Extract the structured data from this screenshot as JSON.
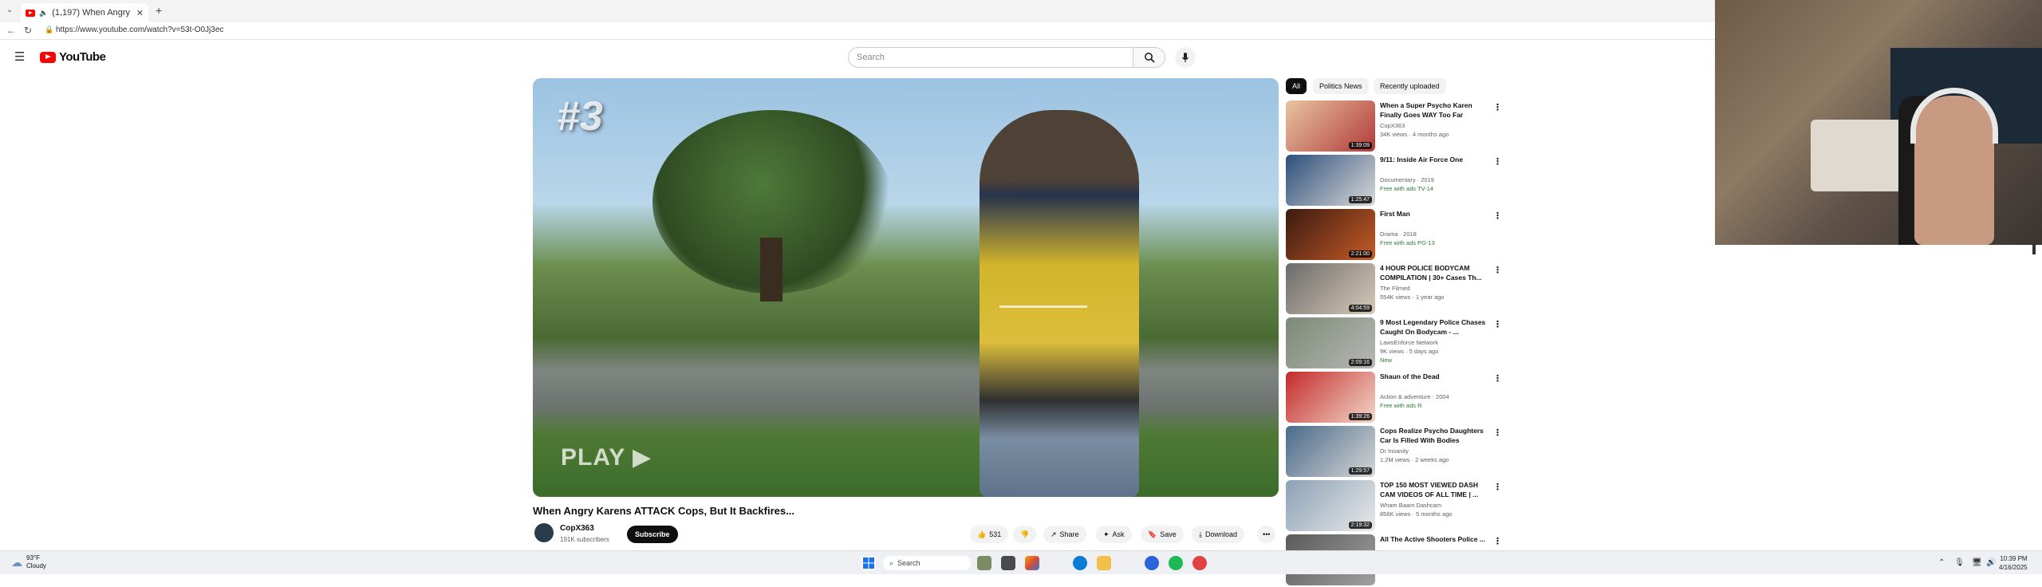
{
  "browser": {
    "tab_title": "(1,197) When Angry Karens ATTACK Cops, But It Backfires...",
    "url": "https://www.youtube.com/watch?v=53t-O0Jj3ec",
    "new_tab_label": "+"
  },
  "header": {
    "logo_text": "YouTube",
    "search_placeholder": "Search"
  },
  "video": {
    "overlay_rank": "#3",
    "overlay_watermark": "PLAY ▶",
    "title": "When Angry Karens ATTACK Cops, But It Backfires...",
    "channel_name": "CopX363",
    "channel_subs": "191K subscribers",
    "subscribe_label": "Subscribe",
    "likes": "531",
    "share_label": "Share",
    "ask_label": "Ask",
    "save_label": "Save",
    "download_label": "Download",
    "more_label": "•••"
  },
  "sidebar": {
    "chips": [
      "All",
      "Politics News",
      "Recently uploaded"
    ],
    "recommendations": [
      {
        "title": "When a Super Psycho Karen Finally Goes WAY Too Far",
        "channel": "CopX363",
        "meta": "34K views · 4 months ago",
        "free": "",
        "duration": "1:39:09",
        "thumb": [
          "#e7c4a0",
          "#b23b3b"
        ]
      },
      {
        "title": "9/11: Inside Air Force One",
        "channel": "Documentary · 2019",
        "meta": "",
        "free": "Free with ads   TV-14",
        "duration": "1:25:47",
        "thumb": [
          "#2d4f7a",
          "#d9d9d9"
        ]
      },
      {
        "title": "First Man",
        "channel": "Drama · 2018",
        "meta": "",
        "free": "Free with ads   PG-13",
        "duration": "2:21:00",
        "thumb": [
          "#3a1a10",
          "#c65b26"
        ]
      },
      {
        "title": "4 HOUR POLICE BODYCAM COMPILATION | 30+ Cases Th...",
        "channel": "The Filmed",
        "meta": "554K views · 1 year ago",
        "free": "",
        "duration": "4:04:59",
        "thumb": [
          "#6b6b6b",
          "#d8c9b7"
        ]
      },
      {
        "title": "9 Most Legendary Police Chases Caught On Bodycam - ...",
        "channel": "LawsEnforce Network",
        "meta": "9K views · 5 days ago",
        "free": "New",
        "duration": "2:09:16",
        "thumb": [
          "#7c8a74",
          "#b7b7b7"
        ]
      },
      {
        "title": "Shaun of the Dead",
        "channel": "Action & adventure · 2004",
        "meta": "",
        "free": "Free with ads   R",
        "duration": "1:39:26",
        "thumb": [
          "#c42a2a",
          "#f2d8c9"
        ]
      },
      {
        "title": "Cops Realize Psycho Daughters Car Is Filled With Bodies",
        "channel": "Dr Insanity",
        "meta": "1.2M views · 2 weeks ago",
        "free": "",
        "duration": "1:29:57",
        "thumb": [
          "#4a6a8a",
          "#d6d6d6"
        ]
      },
      {
        "title": "TOP 150 MOST VIEWED DASH CAM VIDEOS OF ALL TIME | ...",
        "channel": "Wham Baam Dashcam",
        "meta": "856K views · 5 months ago",
        "free": "",
        "duration": "2:19:32",
        "thumb": [
          "#8ba1b5",
          "#e9e9e9"
        ]
      },
      {
        "title": "All The Active Shooters Police ...",
        "channel": "",
        "meta": "",
        "free": "",
        "duration": "",
        "thumb": [
          "#5a5a5a",
          "#a0a0a0"
        ]
      }
    ]
  },
  "taskbar": {
    "temperature": "93°F",
    "condition": "Cloudy",
    "search_label": "Search",
    "time": "10:39 PM",
    "date": "4/16/2025"
  }
}
